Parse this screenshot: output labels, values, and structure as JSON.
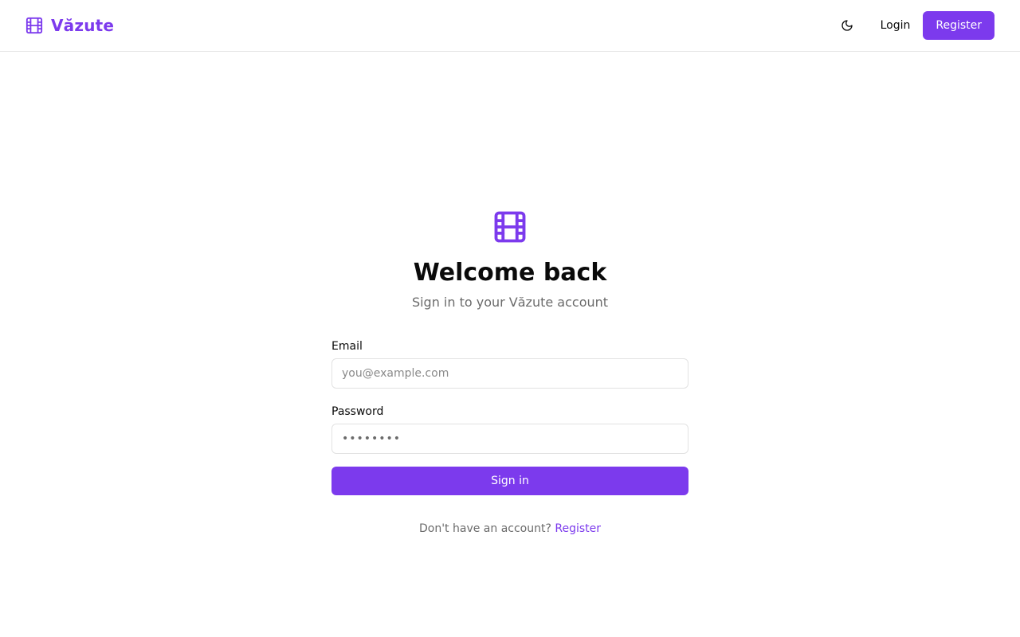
{
  "header": {
    "brand_name": "Văzute",
    "brand_icon": "film-icon",
    "theme_toggle_icon": "moon-icon",
    "login_label": "Login",
    "register_label": "Register"
  },
  "main": {
    "icon": "film-icon",
    "title": "Welcome back",
    "subtitle": "Sign in to your Văzute account",
    "email": {
      "label": "Email",
      "placeholder": "you@example.com",
      "value": ""
    },
    "password": {
      "label": "Password",
      "placeholder": "••••••••",
      "value": ""
    },
    "submit_label": "Sign in",
    "signup_prompt": "Don't have an account?",
    "signup_link": "Register"
  },
  "colors": {
    "accent": "#7c3aed",
    "text": "#0a0a0a",
    "muted": "#6b6b6b",
    "border": "#e5e5e5"
  }
}
